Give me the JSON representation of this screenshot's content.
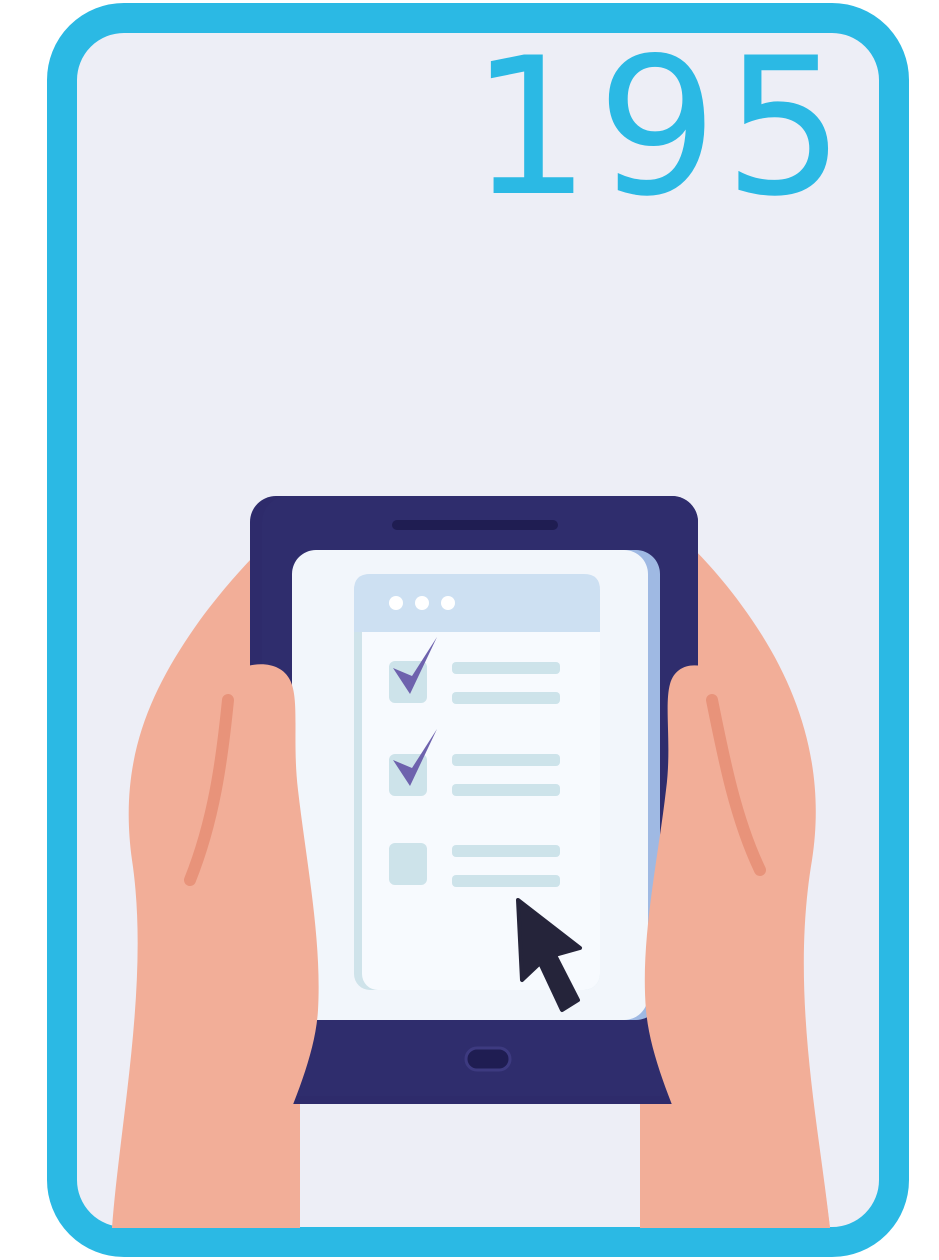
{
  "card": {
    "number": "195",
    "accent_color": "#2bb9e4",
    "background_color": "#edeef6"
  },
  "illustration": {
    "subject": "hands-holding-tablet",
    "checklist": [
      {
        "checked": true
      },
      {
        "checked": true
      },
      {
        "checked": false
      }
    ],
    "window_dots": 3,
    "cursor": "arrow-cursor-icon"
  }
}
